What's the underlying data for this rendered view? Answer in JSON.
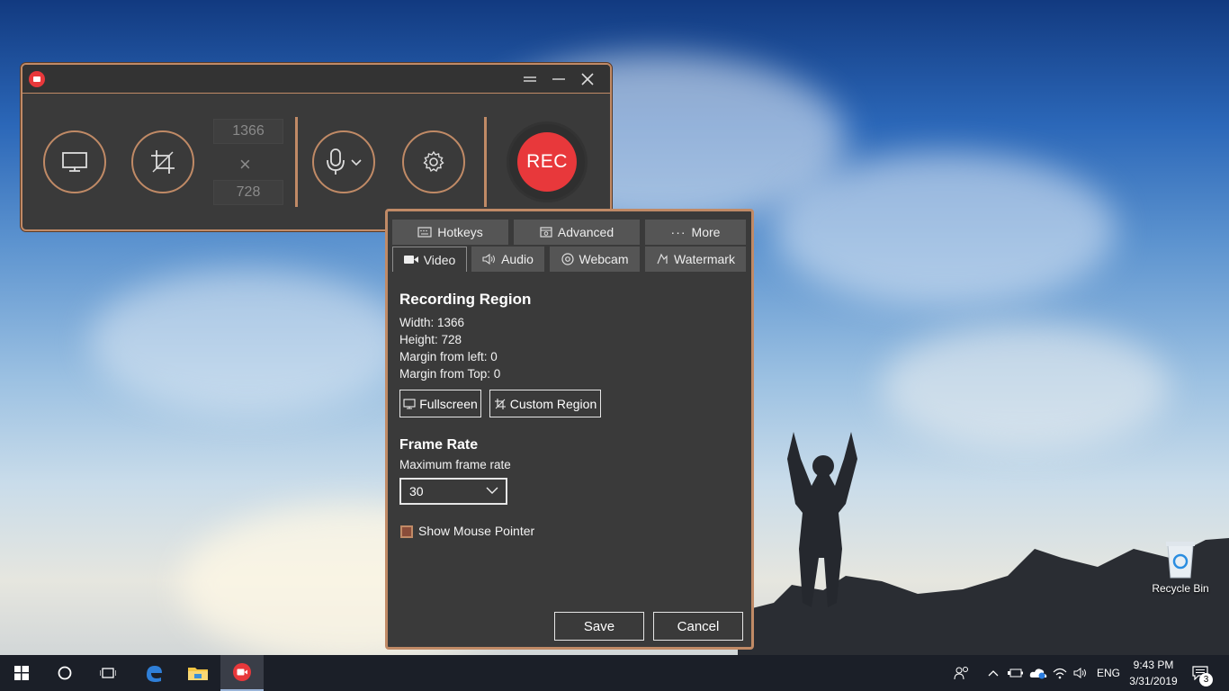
{
  "recorder": {
    "width_value": "1366",
    "height_value": "728",
    "times_symbol": "×",
    "rec_label": "REC",
    "icons": [
      "app-logo-icon",
      "drag-handle-icon",
      "minimize-icon",
      "close-icon",
      "monitor-icon",
      "crop-icon",
      "microphone-icon",
      "chevron-down-icon",
      "gear-icon"
    ]
  },
  "settings": {
    "tabs_row1": [
      {
        "label": "Hotkeys",
        "icon": "keyboard-icon"
      },
      {
        "label": "Advanced",
        "icon": "advanced-icon"
      },
      {
        "label": "More",
        "icon": "ellipsis-icon"
      }
    ],
    "tabs_row2": [
      {
        "label": "Video",
        "icon": "video-camera-icon",
        "active": true
      },
      {
        "label": "Audio",
        "icon": "speaker-icon"
      },
      {
        "label": "Webcam",
        "icon": "webcam-icon"
      },
      {
        "label": "Watermark",
        "icon": "watermark-icon"
      }
    ],
    "recording_region": {
      "heading": "Recording Region",
      "width": "Width:  1366",
      "height": "Height:  728",
      "margin_left": "Margin from left:  0",
      "margin_top": "Margin from Top:  0",
      "fullscreen_label": "Fullscreen",
      "custom_region_label": "Custom Region"
    },
    "frame_rate": {
      "heading": "Frame Rate",
      "subtitle": "Maximum frame rate",
      "selected": "30"
    },
    "show_mouse_pointer": {
      "label": "Show Mouse Pointer",
      "checked": true
    },
    "save_label": "Save",
    "cancel_label": "Cancel"
  },
  "desktop": {
    "recycle_bin_label": "Recycle Bin"
  },
  "taskbar": {
    "language": "ENG",
    "time": "9:43 PM",
    "date": "3/31/2019",
    "notification_count": "3",
    "pinned": [
      "windows-start-icon",
      "cortana-icon",
      "task-view-icon",
      "edge-icon",
      "file-explorer-icon",
      "recorder-app-icon"
    ]
  },
  "colors": {
    "accent": "#c08a66",
    "rec": "#e8383b",
    "panel": "#3a3a3a"
  }
}
